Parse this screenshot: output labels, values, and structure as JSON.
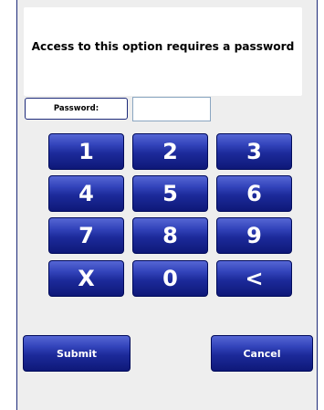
{
  "message": "Access to this option requires a password",
  "password": {
    "label": "Password:",
    "value": "",
    "placeholder": ""
  },
  "keypad": {
    "k1": "1",
    "k2": "2",
    "k3": "3",
    "k4": "4",
    "k5": "5",
    "k6": "6",
    "k7": "7",
    "k8": "8",
    "k9": "9",
    "clear": "X",
    "k0": "0",
    "backspace": "<"
  },
  "actions": {
    "submit": "Submit",
    "cancel": "Cancel"
  },
  "colors": {
    "key_top": "#5566d4",
    "key_bottom": "#0e1878",
    "border": "#1d2a7a",
    "panel_background": "#eeeeee"
  }
}
